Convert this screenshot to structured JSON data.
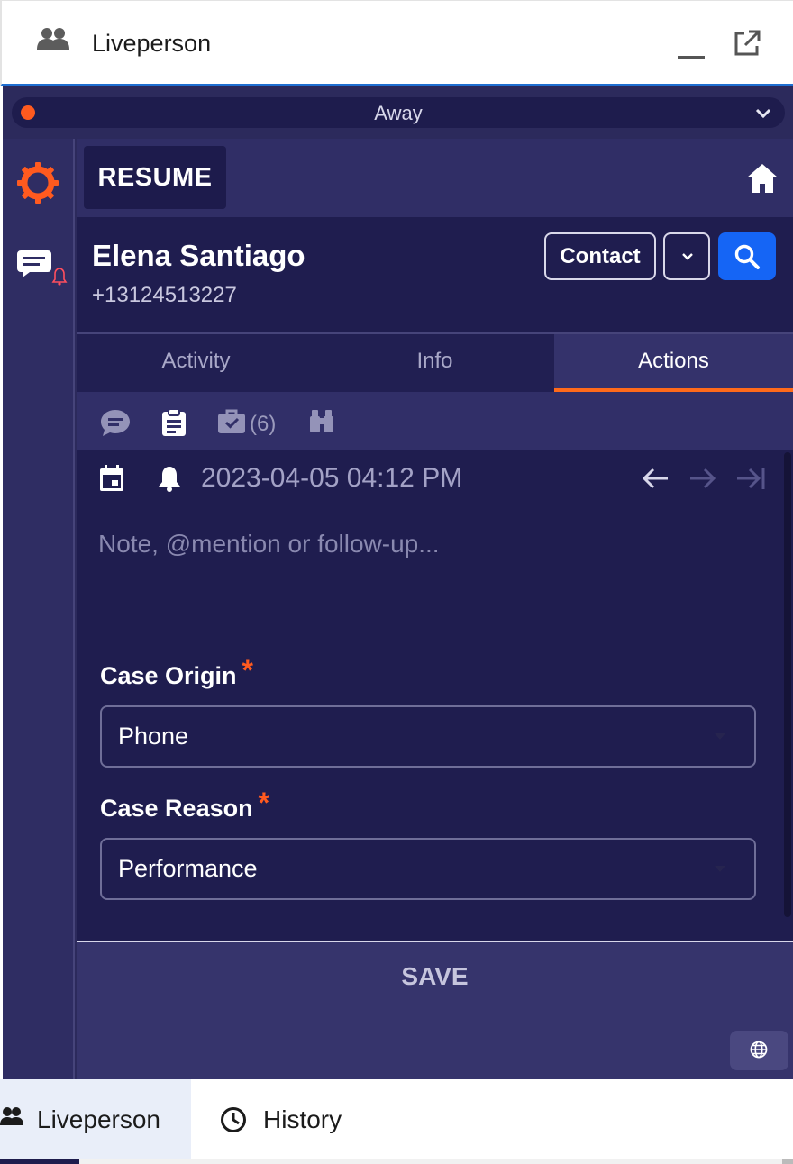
{
  "window": {
    "title": "Liveperson"
  },
  "status": {
    "label": "Away",
    "color": "#ff5a1f"
  },
  "topbar": {
    "resume_label": "RESUME"
  },
  "contact": {
    "name": "Elena Santiago",
    "phone": "+13124513227",
    "contact_button": "Contact"
  },
  "tabs": [
    {
      "label": "Activity",
      "active": false
    },
    {
      "label": "Info",
      "active": false
    },
    {
      "label": "Actions",
      "active": true
    }
  ],
  "subtoolbar": {
    "icons": [
      "chat-bubble-icon",
      "clipboard-icon",
      "briefcase-check-icon",
      "binoculars-icon"
    ],
    "task_count": "(6)"
  },
  "note": {
    "datetime": "2023-04-05 04:12 PM",
    "placeholder": "Note, @mention or follow-up..."
  },
  "fields": {
    "case_origin": {
      "label": "Case Origin",
      "required_mark": "*",
      "value": "Phone"
    },
    "case_reason": {
      "label": "Case Reason",
      "required_mark": "*",
      "value": "Performance"
    }
  },
  "actions": {
    "save_label": "SAVE"
  },
  "taskbar": {
    "tabs": [
      {
        "label": "Liveperson",
        "active": true
      },
      {
        "label": "History",
        "active": false
      }
    ]
  },
  "colors": {
    "accent": "#ff6a1a",
    "primary_blue": "#1565f5",
    "panel_bg": "#2c2a5c",
    "dark_bg": "#1f1d4f"
  }
}
